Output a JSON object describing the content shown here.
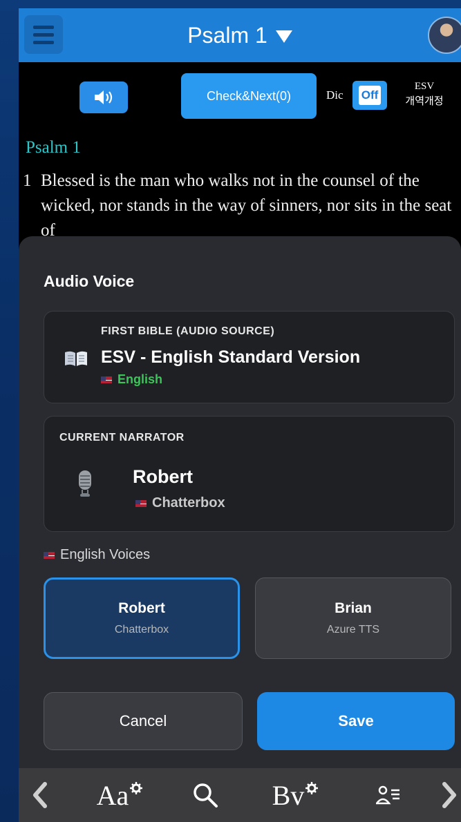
{
  "header": {
    "title": "Psalm 1"
  },
  "controls": {
    "check_next_label": "Check&Next(0)",
    "dic_label": "Dic",
    "dic_toggle": "Off",
    "version_primary": "ESV",
    "version_secondary": "개역개정"
  },
  "passage": {
    "chapter_heading": "Psalm 1",
    "verse_number": "1",
    "verse_text": "Blessed is the man who walks not in the counsel of the wicked, nor stands in the way of sinners, nor sits in the seat of"
  },
  "sheet": {
    "title": "Audio Voice",
    "first_bible": {
      "caption": "FIRST BIBLE (AUDIO SOURCE)",
      "name": "ESV - English Standard Version",
      "language": "English"
    },
    "narrator": {
      "caption": "CURRENT NARRATOR",
      "name": "Robert",
      "source": "Chatterbox"
    },
    "voices_label": "English Voices",
    "voices": [
      {
        "name": "Robert",
        "source": "Chatterbox",
        "selected": true
      },
      {
        "name": "Brian",
        "source": "Azure TTS",
        "selected": false
      }
    ],
    "cancel_label": "Cancel",
    "save_label": "Save"
  },
  "bottom_nav": {
    "font_label": "Aa",
    "bible_label": "Bv"
  },
  "colors": {
    "accent": "#1e88e5",
    "topbar": "#1e7fd6",
    "chapter_heading": "#2ec6c9",
    "language_green": "#3dc45a"
  },
  "icons": [
    "menu-icon",
    "chevron-down-icon",
    "speaker-icon",
    "book-icon",
    "microphone-icon",
    "us-flag-icon",
    "chevron-left-icon",
    "search-icon",
    "gear-icon",
    "person-list-icon",
    "chevron-right-icon"
  ]
}
